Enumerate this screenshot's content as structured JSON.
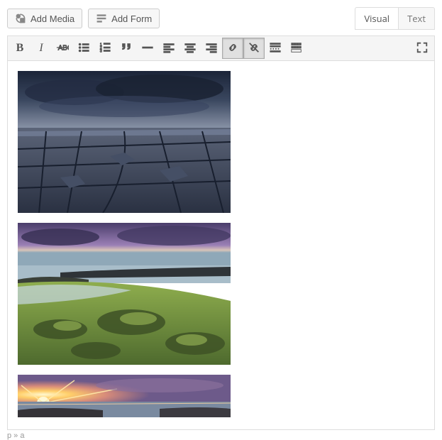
{
  "topbar": {
    "add_media": "Add Media",
    "add_form": "Add Form"
  },
  "tabs": {
    "visual": "Visual",
    "text": "Text",
    "active": "visual"
  },
  "toolbar": {
    "bold_glyph": "B",
    "italic_glyph": "I",
    "link_pressed": true,
    "unlink_pressed": true
  },
  "images": [
    {
      "alt": "stormy rocky terrain"
    },
    {
      "alt": "mossy coastal rocks at dusk"
    },
    {
      "alt": "sunset over ocean"
    }
  ],
  "crumbs": "p » a"
}
